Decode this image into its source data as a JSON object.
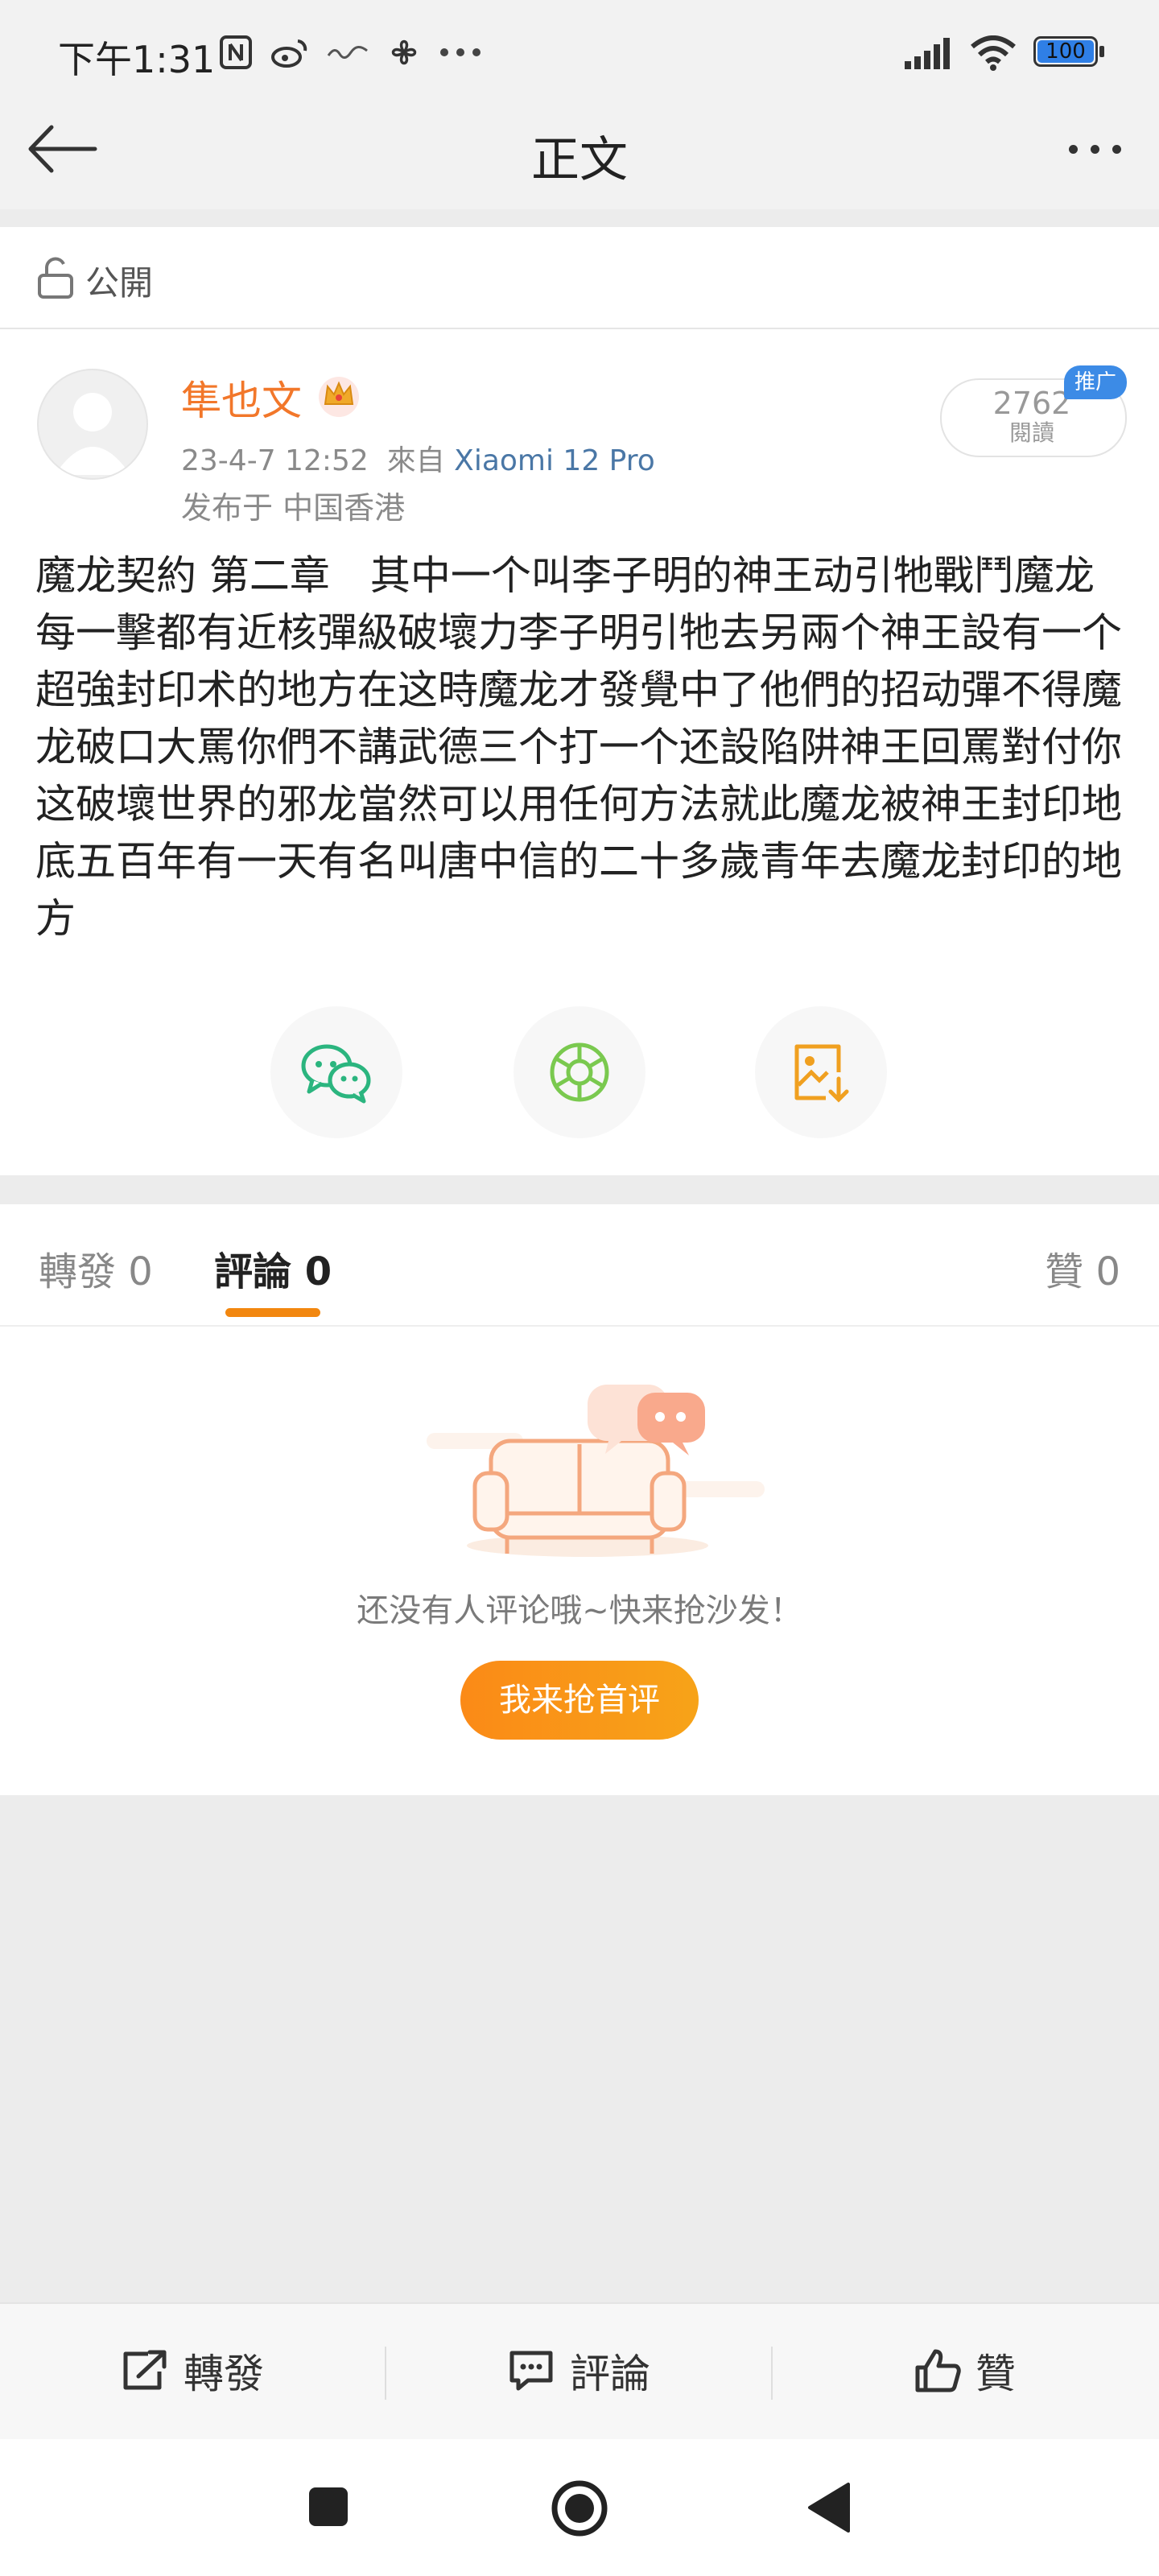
{
  "status_bar": {
    "time": "下午1:31",
    "battery": "100"
  },
  "header": {
    "title": "正文"
  },
  "visibility": {
    "label": "公開"
  },
  "post": {
    "author": "隼也文",
    "date": "23-4-7 12:52",
    "via_prefix": "來自",
    "device": "Xiaomi 12 Pro",
    "location": "发布于 中国香港",
    "read_count": "2762",
    "read_label": "閱讀",
    "promo_tag": "推广",
    "body": "魔龙契約 第二章　其中一个叫李子明的神王动引牠戰鬥魔龙每一擊都有近核彈級破壞力李子明引牠去另兩个神王設有一个超強封印术的地方在这時魔龙才發覺中了他們的招动彈不得魔龙破口大罵你們不講武德三个打一个还設陷阱神王回罵對付你这破壞世界的邪龙當然可以用任何方法就此魔龙被神王封印地底五百年有一天有名叫唐中信的二十多歲青年去魔龙封印的地方"
  },
  "share": {
    "items": [
      "wechat-icon",
      "moments-icon",
      "save-image-icon"
    ]
  },
  "tabs": {
    "repost": "轉發 0",
    "comments": "評論 0",
    "likes": "贊 0"
  },
  "empty_state": {
    "text": "还没有人评论哦~快来抢沙发！",
    "button": "我来抢首评"
  },
  "bottom_bar": {
    "repost": "轉發",
    "comment": "評論",
    "like": "贊"
  },
  "colors": {
    "accent_orange": "#f2870f",
    "author_orange": "#f2772a",
    "link_blue": "#4a77a6",
    "promo_blue": "#3c8be6"
  }
}
